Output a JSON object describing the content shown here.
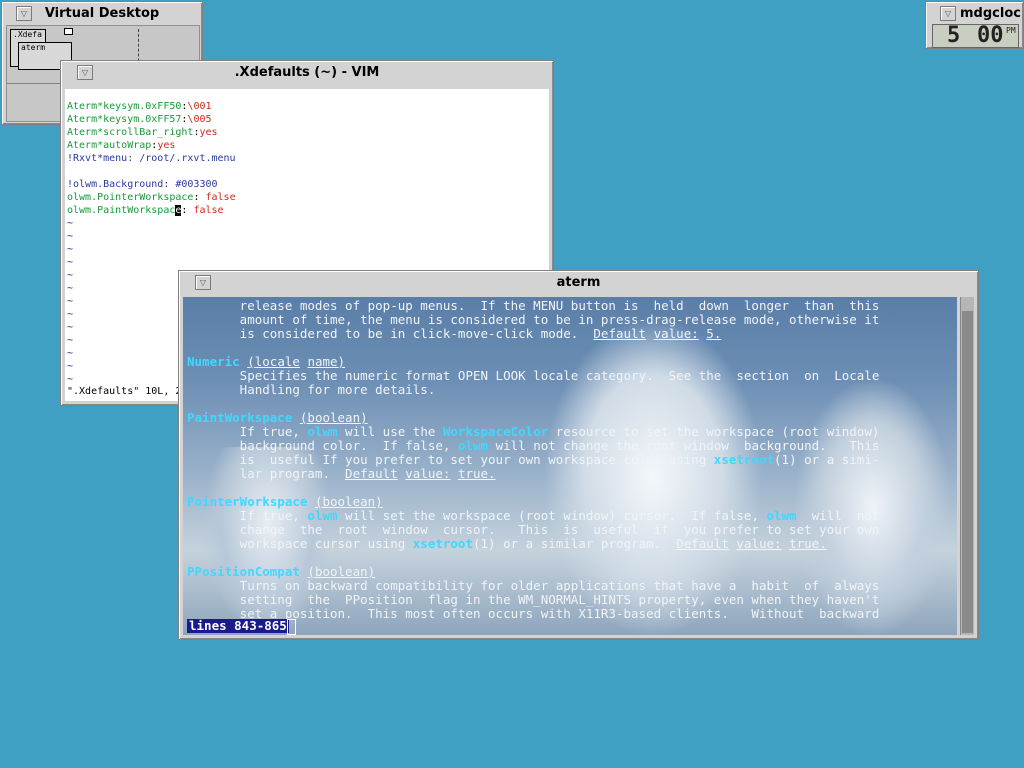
{
  "virtual_desktop": {
    "title": "Virtual Desktop",
    "mini_windows": [
      ".Xdefa",
      "aterm"
    ]
  },
  "clock": {
    "title": "mdgcloc",
    "hour": "5",
    "minutes": "00",
    "ampm": "PM"
  },
  "vim": {
    "title": ".Xdefaults (~) - VIM",
    "status_line": "\".Xdefaults\" 10L, 2"
  },
  "aterm": {
    "title": "aterm",
    "status": "lines 843-865"
  },
  "colors": {
    "desktop": "#3fa0c4",
    "chrome": "#d3d3d3",
    "man_heading": "#40d8ff",
    "status_bg": "#1a1a8a"
  }
}
